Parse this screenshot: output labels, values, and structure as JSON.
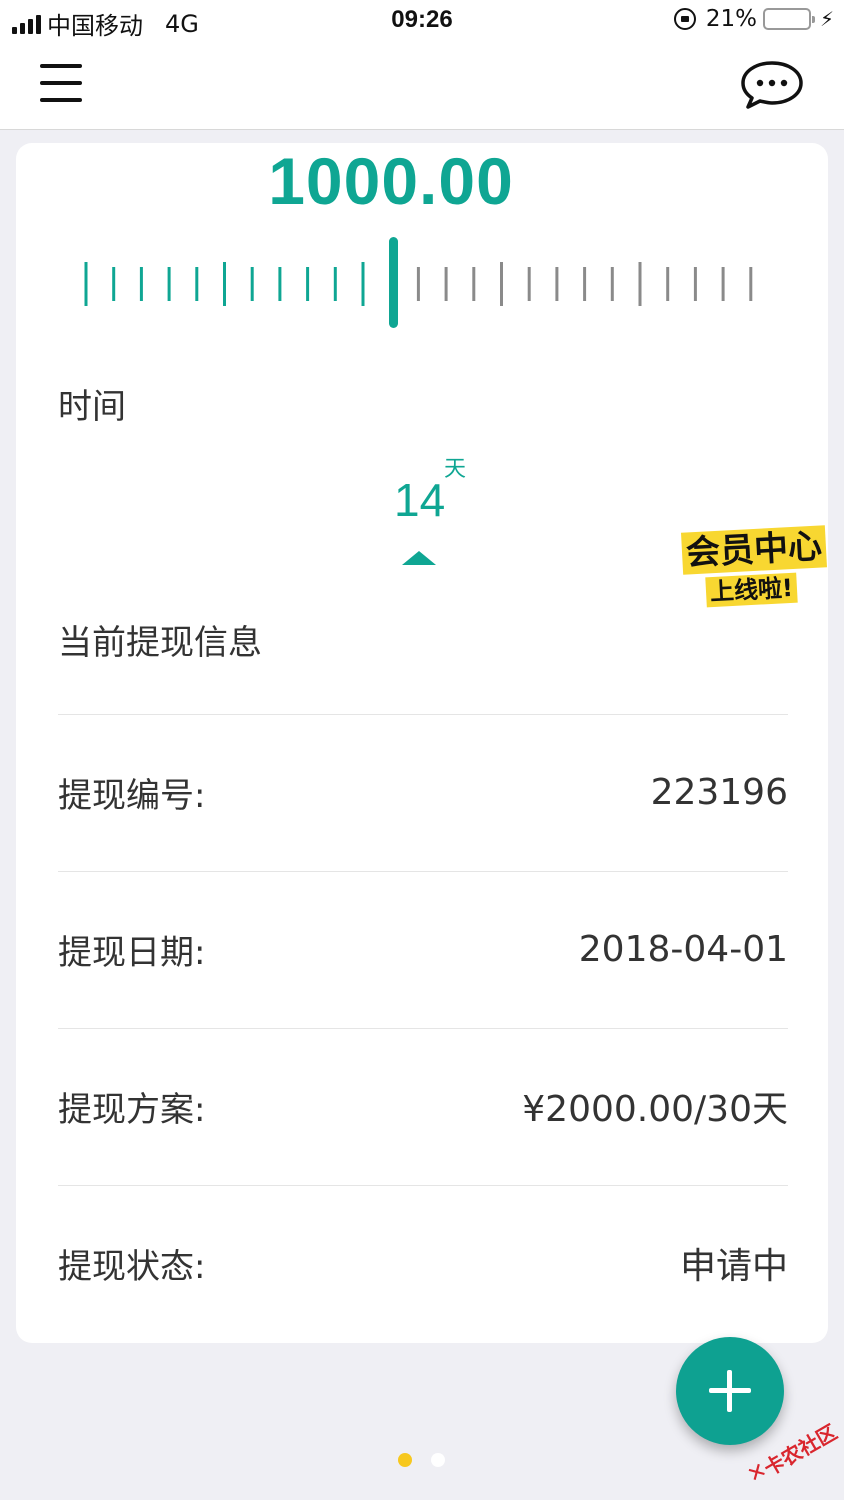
{
  "status_bar": {
    "carrier": "中国移动",
    "network": "4G",
    "time": "09:26",
    "battery_percent": "21%",
    "battery_level": 0.21
  },
  "header": {
    "menu_icon": "hamburger-menu-icon",
    "chat_icon": "chat-bubble-icon"
  },
  "amount": {
    "value": "1000.00",
    "accent_color": "#0fa693"
  },
  "term": {
    "label": "时间",
    "days": "14",
    "unit": "天"
  },
  "promo": {
    "line1": "会员中心",
    "line2": "上线啦!"
  },
  "section_title": "当前提现信息",
  "info": [
    {
      "key": "提现编号:",
      "value": "223196"
    },
    {
      "key": "提现日期:",
      "value": "2018-04-01"
    },
    {
      "key": "提现方案:",
      "value": "¥2000.00/30天"
    },
    {
      "key": "提现状态:",
      "value": "申请中"
    }
  ],
  "pager": {
    "count": 2,
    "active_index": 0
  },
  "fab_icon": "plus-icon",
  "watermark": "卡农社区"
}
